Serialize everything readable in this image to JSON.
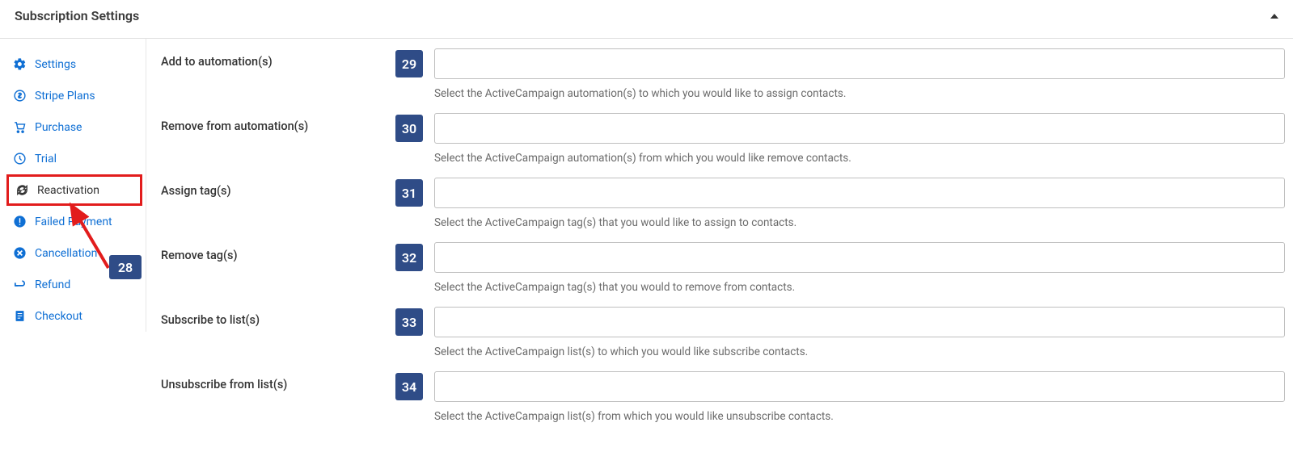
{
  "header": {
    "title": "Subscription Settings"
  },
  "sidebar": {
    "items": [
      {
        "label": "Settings"
      },
      {
        "label": "Stripe Plans"
      },
      {
        "label": "Purchase"
      },
      {
        "label": "Trial"
      },
      {
        "label": "Reactivation"
      },
      {
        "label": "Failed Payment"
      },
      {
        "label": "Cancellation"
      },
      {
        "label": "Refund"
      },
      {
        "label": "Checkout"
      }
    ]
  },
  "annotations": {
    "sidebar_badge": "28"
  },
  "fields": [
    {
      "label": "Add to automation(s)",
      "badge": "29",
      "help": "Select the ActiveCampaign automation(s) to which you would like to assign contacts."
    },
    {
      "label": "Remove from automation(s)",
      "badge": "30",
      "help": "Select the ActiveCampaign automation(s) from which you would like remove contacts."
    },
    {
      "label": "Assign tag(s)",
      "badge": "31",
      "help": "Select the ActiveCampaign tag(s) that you would like to assign to contacts."
    },
    {
      "label": "Remove tag(s)",
      "badge": "32",
      "help": "Select the ActiveCampaign tag(s) that you would to remove from contacts."
    },
    {
      "label": "Subscribe to list(s)",
      "badge": "33",
      "help": "Select the ActiveCampaign list(s) to which you would like subscribe contacts."
    },
    {
      "label": "Unsubscribe from list(s)",
      "badge": "34",
      "help": "Select the ActiveCampaign list(s) from which you would like unsubscribe contacts."
    }
  ]
}
